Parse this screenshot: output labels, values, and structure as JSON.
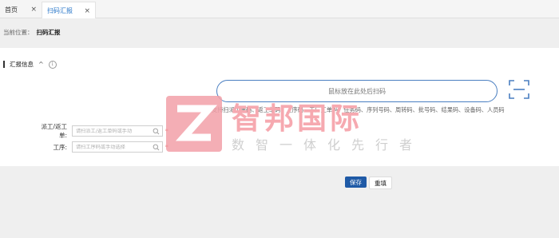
{
  "tabs": [
    {
      "label": "首页",
      "active": false
    },
    {
      "label": "扫码汇报",
      "active": true
    }
  ],
  "tab_close_glyph": "×",
  "breadcrumb": {
    "prefix": "当前位置：",
    "current": "扫码汇报"
  },
  "section": {
    "title": "汇报信息",
    "caret": "^",
    "info_glyph": "i"
  },
  "scan": {
    "placeholder": "鼠标放在此处后扫码",
    "hint": "支持扫派工单码、返工单码、工序码、工厂工单码、任务码、序列号码、周转码、批号码、结果码、设备码、人员码"
  },
  "form": {
    "dispatch_label": "派工/返工单:",
    "dispatch_placeholder": "请扫派工/返工单码或手动",
    "process_label": "工序:",
    "process_placeholder": "请扫工序码或手动选择",
    "required_mark": "*"
  },
  "watermark": {
    "name": "智邦国际",
    "slogan": "数智一体化先行者"
  },
  "buttons": {
    "save": "保存",
    "reset": "重填"
  },
  "colors": {
    "accent": "#1f5aa6",
    "scan_border": "#4a7fc1",
    "required": "#e53935",
    "watermark_logo": "#f2a0a8"
  }
}
